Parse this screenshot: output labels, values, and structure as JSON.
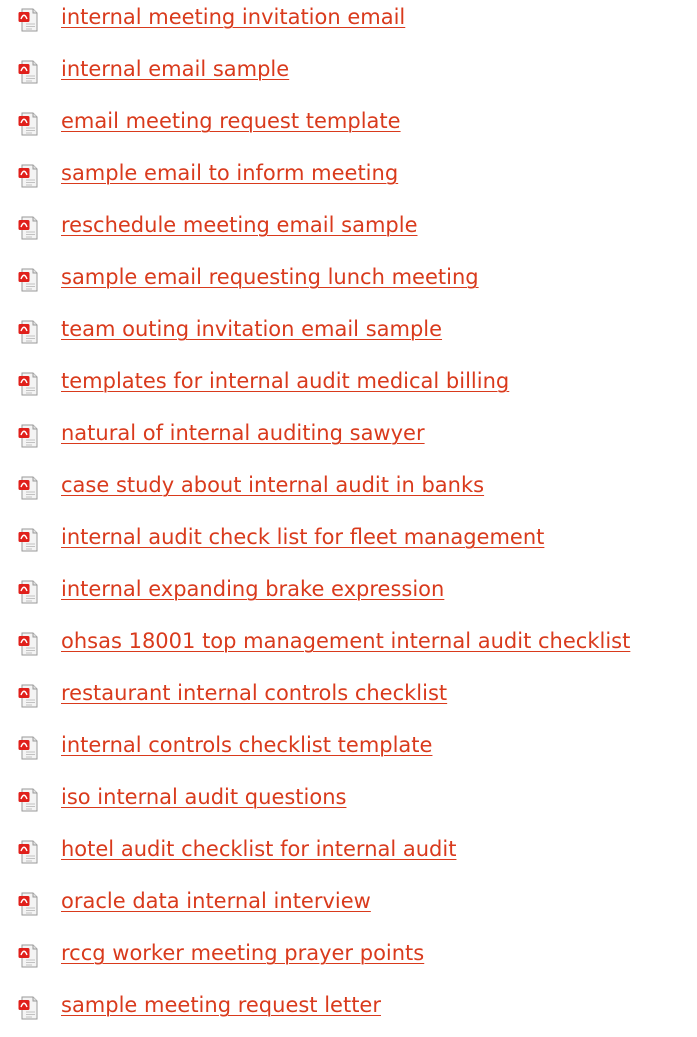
{
  "links": [
    {
      "text": "internal meeting invitation email",
      "icon": "pdf-file-icon"
    },
    {
      "text": "internal email sample",
      "icon": "pdf-file-icon"
    },
    {
      "text": "email meeting request template",
      "icon": "pdf-file-icon"
    },
    {
      "text": "sample email to inform meeting",
      "icon": "pdf-file-icon"
    },
    {
      "text": "reschedule meeting email sample",
      "icon": "pdf-file-icon"
    },
    {
      "text": "sample email requesting lunch meeting",
      "icon": "pdf-file-icon"
    },
    {
      "text": "team outing invitation email sample",
      "icon": "pdf-file-icon"
    },
    {
      "text": "templates for internal audit medical billing",
      "icon": "pdf-file-icon"
    },
    {
      "text": "natural of internal auditing sawyer",
      "icon": "pdf-file-icon"
    },
    {
      "text": "case study about internal audit in banks",
      "icon": "pdf-file-icon"
    },
    {
      "text": "internal audit check list for fleet management",
      "icon": "pdf-file-icon"
    },
    {
      "text": "internal expanding brake expression",
      "icon": "pdf-file-icon"
    },
    {
      "text": "ohsas 18001 top management internal audit checklist",
      "icon": "pdf-file-icon"
    },
    {
      "text": "restaurant internal controls checklist",
      "icon": "pdf-file-icon"
    },
    {
      "text": "internal controls checklist template",
      "icon": "pdf-file-icon"
    },
    {
      "text": "iso internal audit questions",
      "icon": "pdf-file-icon"
    },
    {
      "text": "hotel audit checklist for internal audit",
      "icon": "pdf-file-icon"
    },
    {
      "text": "oracle data internal interview",
      "icon": "pdf-file-icon"
    },
    {
      "text": "rccg worker meeting prayer points",
      "icon": "pdf-file-icon"
    },
    {
      "text": "sample meeting request letter",
      "icon": "pdf-file-icon"
    }
  ],
  "colors": {
    "link": "#d93a1c",
    "pdf_red": "#e0201b",
    "page_gray": "#d8d8d8"
  }
}
